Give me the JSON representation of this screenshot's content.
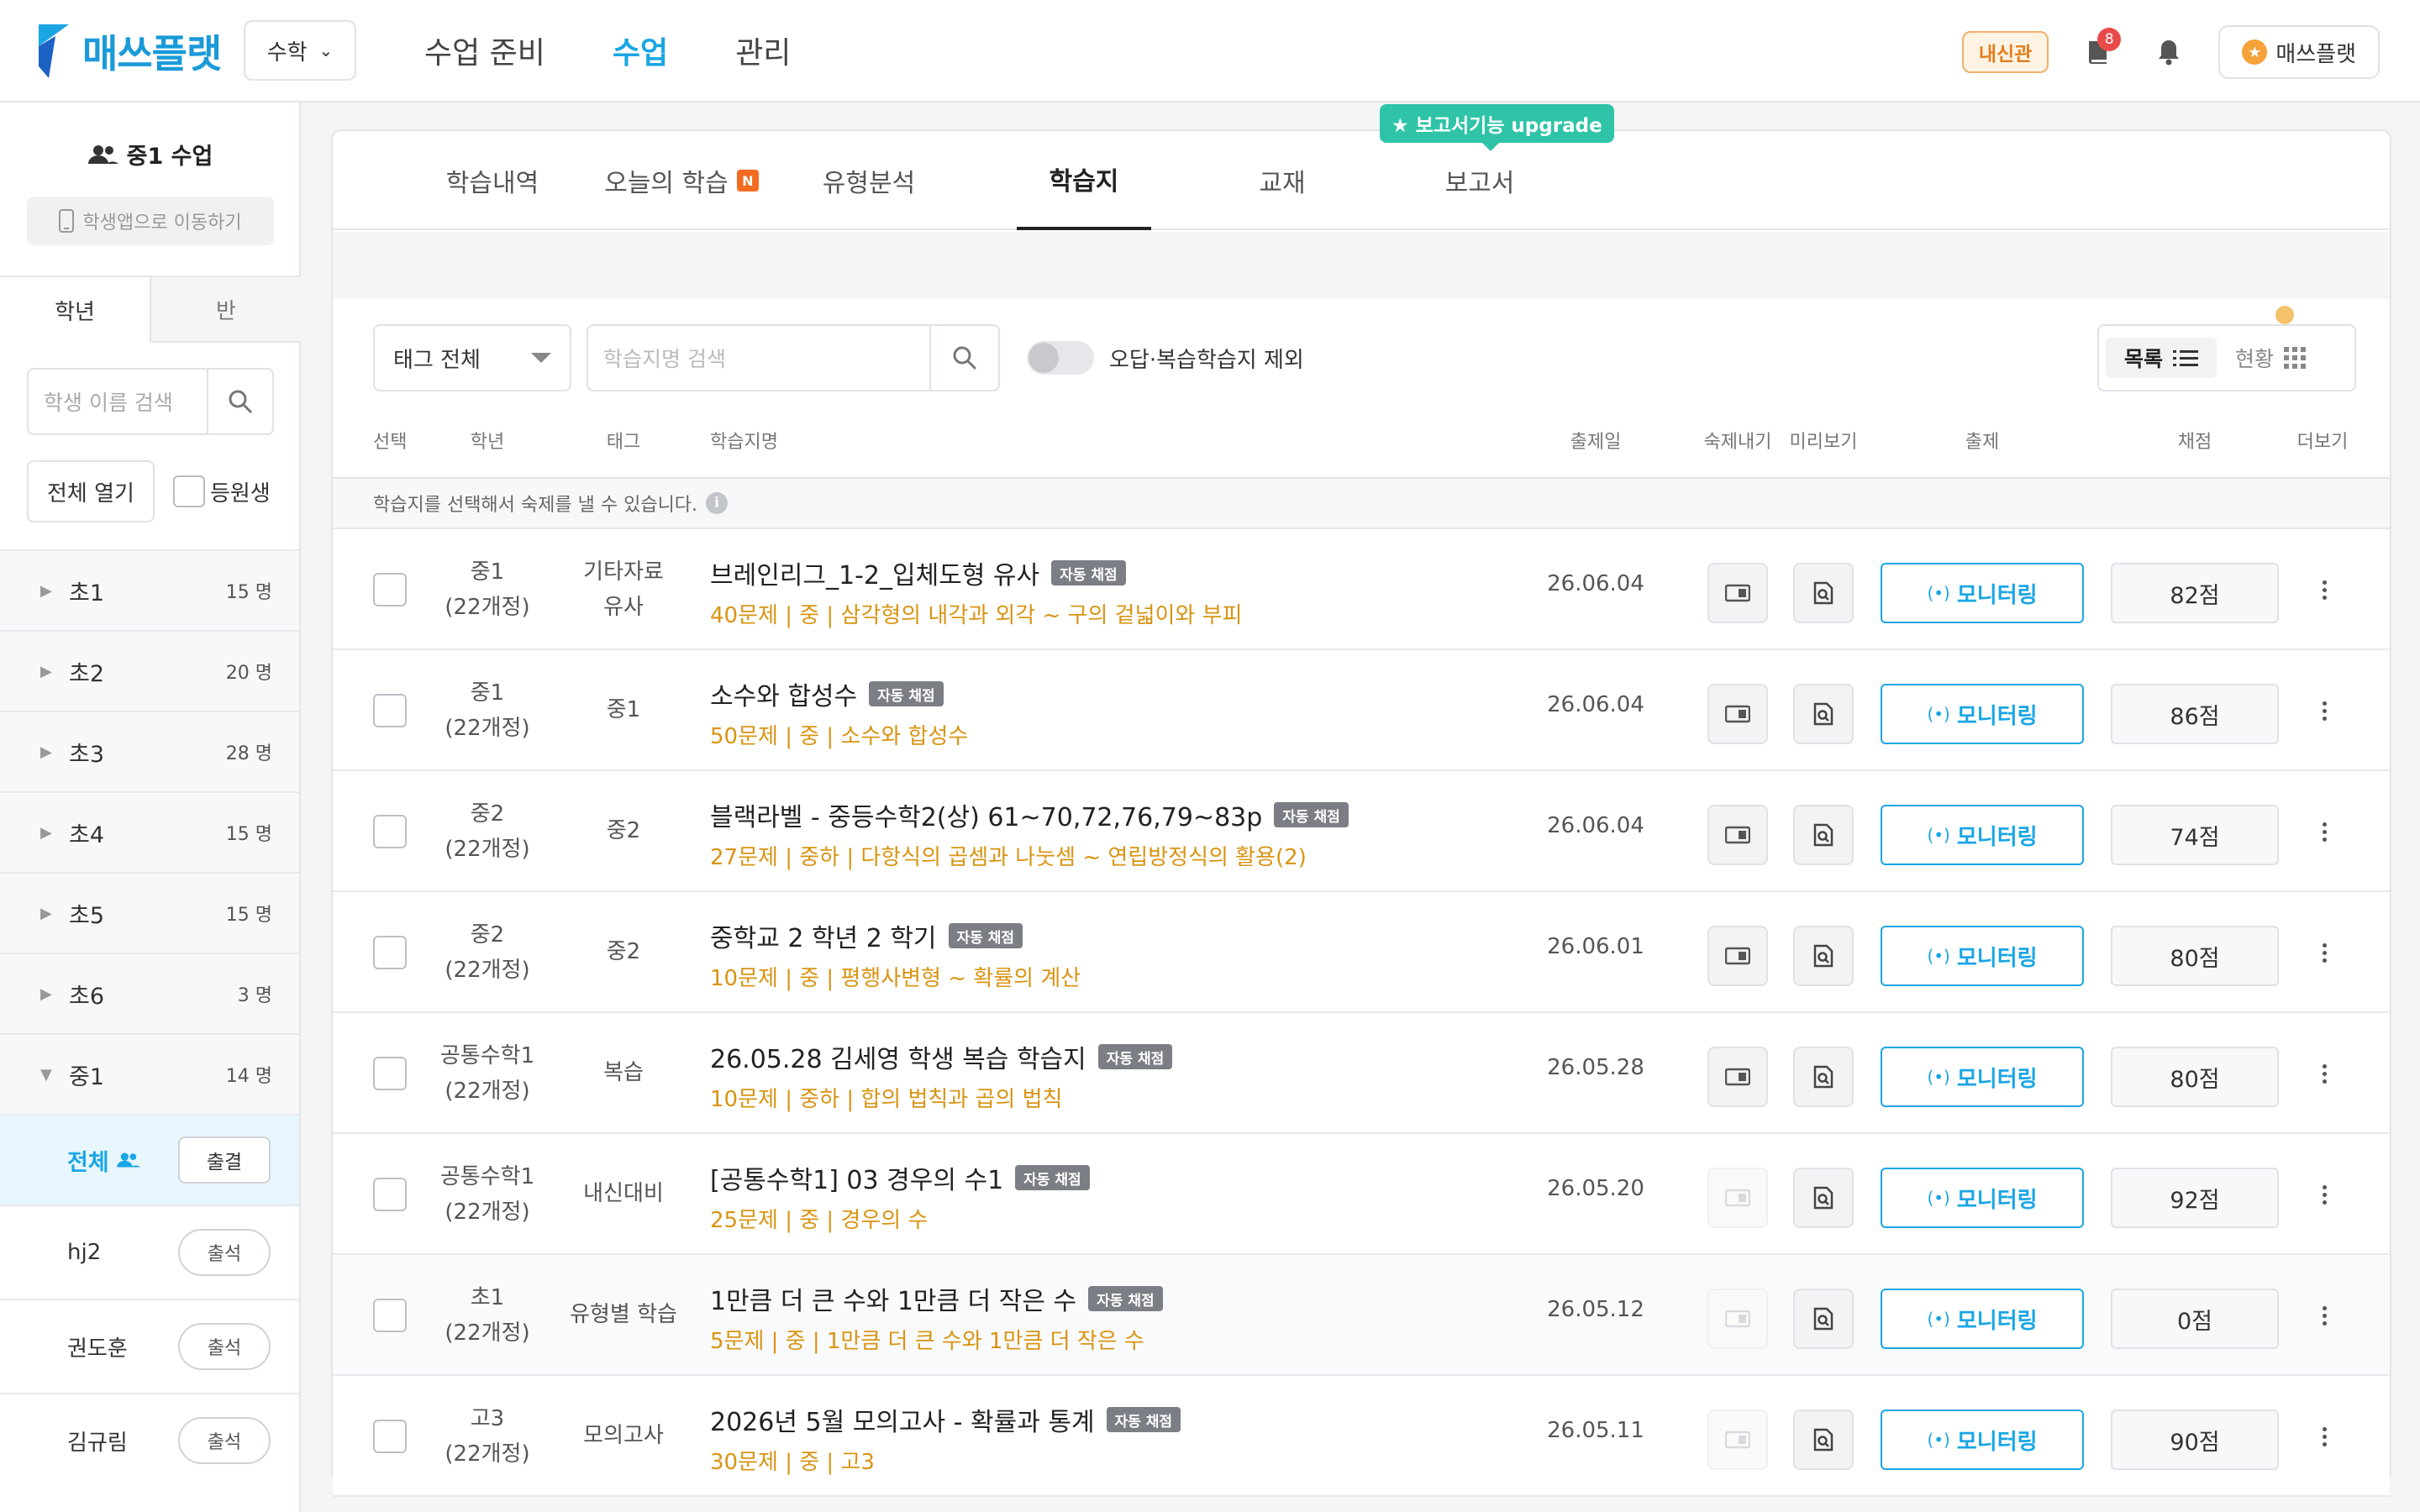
{
  "app": {
    "brand": "매쓰플랫",
    "subject": "수학"
  },
  "mainnav": [
    "수업 준비",
    "수업",
    "관리"
  ],
  "topright": {
    "naesin": "내신관",
    "notif_count": "8",
    "profile": "매쓰플랫"
  },
  "sidebar": {
    "class_title": "중1 수업",
    "app_move": "학생앱으로 이동하기",
    "tabs": [
      "학년",
      "반"
    ],
    "search_placeholder": "학생 이름 검색",
    "open_all": "전체 열기",
    "enrolled": "등원생",
    "grades": [
      {
        "name": "초1",
        "count": "15 명"
      },
      {
        "name": "초2",
        "count": "20 명"
      },
      {
        "name": "초3",
        "count": "28 명"
      },
      {
        "name": "초4",
        "count": "15 명"
      },
      {
        "name": "초5",
        "count": "15 명"
      },
      {
        "name": "초6",
        "count": "3 명"
      },
      {
        "name": "중1",
        "count": "14 명"
      }
    ],
    "all_label": "전체",
    "attend_btn": "출결",
    "students": [
      {
        "name": "hj2",
        "btn": "출석"
      },
      {
        "name": "권도훈",
        "btn": "출석"
      },
      {
        "name": "김규림",
        "btn": "출석"
      }
    ]
  },
  "tabs": [
    "학습내역",
    "오늘의 학습",
    "유형분석",
    "학습지",
    "교재",
    "보고서"
  ],
  "tab_new_badge": "N",
  "upgrade_tip": "★ 보고서기능 upgrade",
  "filters": {
    "tag": "태그 전체",
    "search_placeholder": "학습지명 검색",
    "toggle_label": "오답·복습학습지 제외",
    "view_list": "목록",
    "view_status": "현황"
  },
  "table": {
    "headers": [
      "선택",
      "학년",
      "태그",
      "학습지명",
      "출제일",
      "숙제내기",
      "미리보기",
      "출제",
      "채점",
      "더보기"
    ],
    "info": "학습지를 선택해서 숙제를 낼 수 있습니다.",
    "auto_badge": "자동 채점",
    "monitor_label": "모니터링",
    "rows": [
      {
        "grade": "중1",
        "curr": "(22개정)",
        "tag1": "기타자료",
        "tag2": "유사",
        "title": "브레인리그_1-2_입체도형 유사",
        "sub": "40문제 | 중 | 삼각형의 내각과 외각 ~ 구의 겉넓이와 부피",
        "date": "26.06.04",
        "score": "82점",
        "hw_disabled": false
      },
      {
        "grade": "중1",
        "curr": "(22개정)",
        "tag1": "중1",
        "tag2": "",
        "title": "소수와 합성수",
        "sub": "50문제 | 중 | 소수와 합성수",
        "date": "26.06.04",
        "score": "86점",
        "hw_disabled": false
      },
      {
        "grade": "중2",
        "curr": "(22개정)",
        "tag1": "중2",
        "tag2": "",
        "title": "블랙라벨 - 중등수학2(상) 61~70,72,76,79~83p",
        "sub": "27문제 | 중하 | 다항식의 곱셈과 나눗셈 ~ 연립방정식의 활용(2)",
        "date": "26.06.04",
        "score": "74점",
        "hw_disabled": false
      },
      {
        "grade": "중2",
        "curr": "(22개정)",
        "tag1": "중2",
        "tag2": "",
        "title": "중학교 2 학년 2 학기",
        "sub": "10문제 | 중 | 평행사변형 ~ 확률의 계산",
        "date": "26.06.01",
        "score": "80점",
        "hw_disabled": false
      },
      {
        "grade": "공통수학1",
        "curr": "(22개정)",
        "tag1": "복습",
        "tag2": "",
        "title": "26.05.28 김세영 학생 복습 학습지",
        "sub": "10문제 | 중하 | 합의 법칙과 곱의 법칙",
        "date": "26.05.28",
        "score": "80점",
        "hw_disabled": false
      },
      {
        "grade": "공통수학1",
        "curr": "(22개정)",
        "tag1": "내신대비",
        "tag2": "",
        "title": "[공통수학1] 03 경우의 수1",
        "sub": "25문제 | 중 | 경우의 수",
        "date": "26.05.20",
        "score": "92점",
        "hw_disabled": true
      },
      {
        "grade": "초1",
        "curr": "(22개정)",
        "tag1": "유형별 학습",
        "tag2": "",
        "title": "1만큼 더 큰 수와 1만큼 더 작은 수",
        "sub": "5문제 | 중 | 1만큼 더 큰 수와 1만큼 더 작은 수",
        "date": "26.05.12",
        "score": "0점",
        "hw_disabled": true
      },
      {
        "grade": "고3",
        "curr": "(22개정)",
        "tag1": "모의고사",
        "tag2": "",
        "title": "2026년 5월 모의고사 - 확률과 통계",
        "sub": "30문제 | 중 | 고3",
        "date": "26.05.11",
        "score": "90점",
        "hw_disabled": true
      }
    ]
  },
  "colors": {
    "accent": "#1aa6e4",
    "orange": "#d99413",
    "teal": "#2fc4a8"
  }
}
